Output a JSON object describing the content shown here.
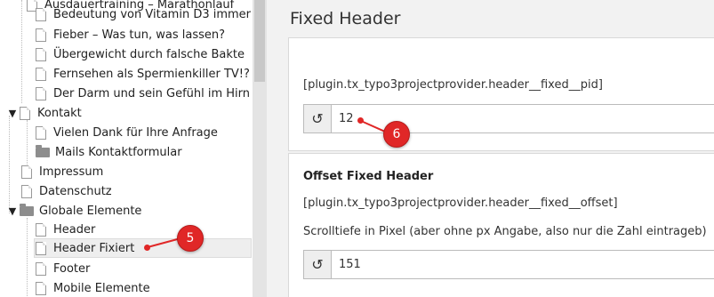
{
  "tree": {
    "items": [
      {
        "label": "Ausdauertraining – Marathonlauf"
      },
      {
        "label": "Bedeutung von Vitamin D3 immer"
      },
      {
        "label": "Fieber – Was tun, was lassen?"
      },
      {
        "label": "Übergewicht durch falsche Bakte"
      },
      {
        "label": "Fernsehen als Spermienkiller TV!?"
      },
      {
        "label": "Der Darm und sein Gefühl im Hirn"
      },
      {
        "label": "Kontakt",
        "expander": "▼"
      },
      {
        "label": "Vielen Dank für Ihre Anfrage"
      },
      {
        "label": "Mails Kontaktformular"
      },
      {
        "label": "Impressum"
      },
      {
        "label": "Datenschutz"
      },
      {
        "label": "Globale Elemente",
        "expander": "▼"
      },
      {
        "label": "Header"
      },
      {
        "label": "Header Fixiert"
      },
      {
        "label": "Footer"
      },
      {
        "label": "Mobile Elemente"
      }
    ]
  },
  "content": {
    "title": "Fixed Header",
    "fields": [
      {
        "constant": "[plugin.tx_typo3projectprovider.header__fixed__pid]",
        "value": "12"
      },
      {
        "title": "Offset Fixed Header",
        "constant": "[plugin.tx_typo3projectprovider.header__fixed__offset]",
        "help": "Scrolltiefe in Pixel (aber ohne px Angabe, also nur die Zahl eintrageb)",
        "value": "151"
      }
    ],
    "reset_icon": "↺"
  },
  "annotations": {
    "marker_5": "5",
    "marker_6": "6"
  },
  "colors": {
    "accent": "#e02727"
  }
}
